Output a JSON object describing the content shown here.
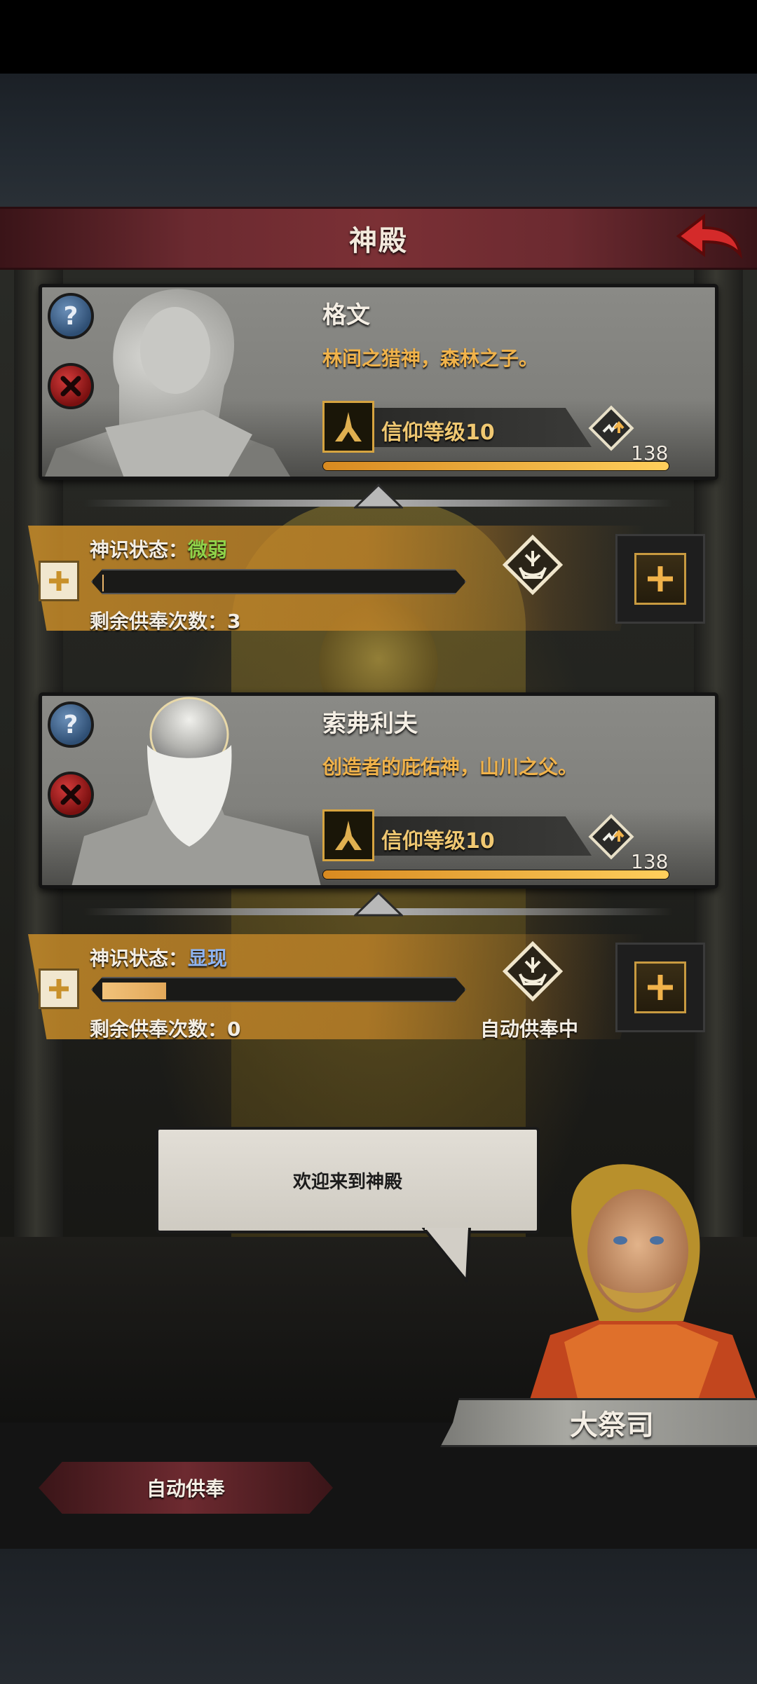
{
  "header": {
    "title": "神殿"
  },
  "gods": [
    {
      "name": "格文",
      "description": "林间之猎神，森林之子。",
      "faith_label": "信仰等级10",
      "faith_count": "138",
      "faith_progress": 1.0,
      "status_label": "神识状态：",
      "status_value": "微弱",
      "sense_progress": 0.0,
      "offerings_label": "剩余供奉次数：3"
    },
    {
      "name": "索弗利夫",
      "description": "创造者的庇佑神，山川之父。",
      "faith_label": "信仰等级10",
      "faith_count": "138",
      "faith_progress": 1.0,
      "status_label": "神识状态：",
      "status_value": "显现",
      "sense_progress": 0.18,
      "offerings_label": "剩余供奉次数：0",
      "auto_status": "自动供奉中"
    }
  ],
  "dialogue": {
    "text": "欢迎来到神殿"
  },
  "npc": {
    "name": "大祭司"
  },
  "footer": {
    "auto_button": "自动供奉"
  },
  "colors": {
    "accent_gold": "#f0b24a",
    "title_red": "#7b3035",
    "status_weak": "#8fd24a",
    "status_show": "#8fb4f0"
  }
}
